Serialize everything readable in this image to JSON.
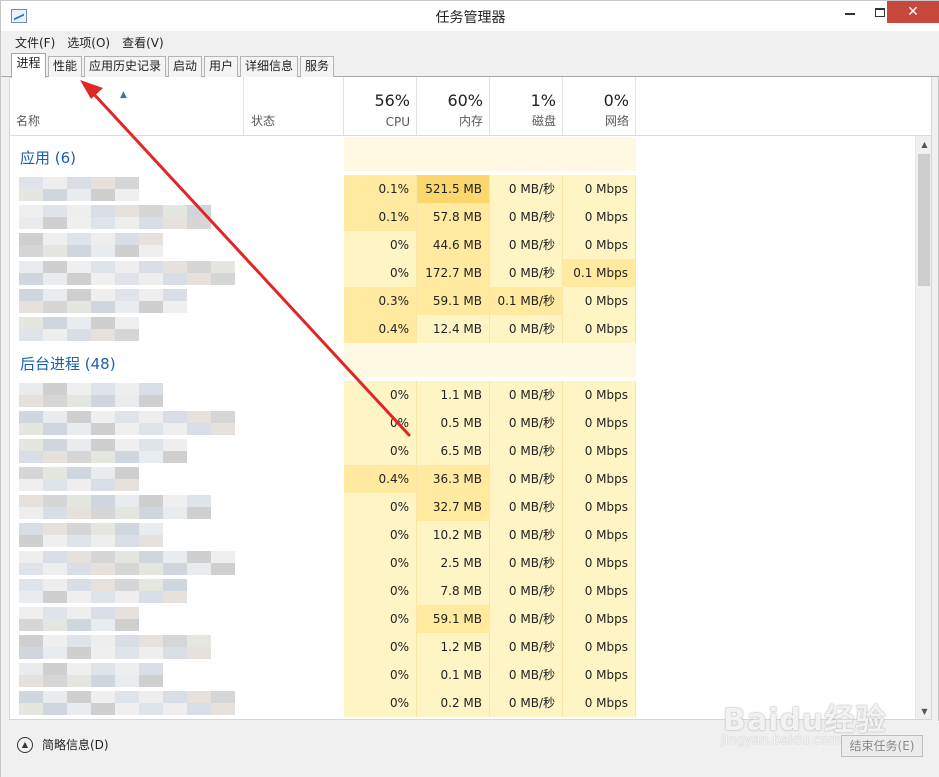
{
  "window": {
    "title": "任务管理器",
    "close_glyph": "✕"
  },
  "menu": [
    "文件(F)",
    "选项(O)",
    "查看(V)"
  ],
  "tabs": [
    "进程",
    "性能",
    "应用历史记录",
    "启动",
    "用户",
    "详细信息",
    "服务"
  ],
  "active_tab": "进程",
  "columns": {
    "name": "名称",
    "status": "状态",
    "metrics": [
      {
        "pct": "56%",
        "label": "CPU"
      },
      {
        "pct": "60%",
        "label": "内存"
      },
      {
        "pct": "1%",
        "label": "磁盘"
      },
      {
        "pct": "0%",
        "label": "网络"
      }
    ]
  },
  "groups": [
    {
      "title": "应用 (6)",
      "rows": [
        {
          "cpu": "0.1%",
          "mem": "521.5 MB",
          "disk": "0 MB/秒",
          "net": "0 Mbps"
        },
        {
          "cpu": "0.1%",
          "mem": "57.8 MB",
          "disk": "0 MB/秒",
          "net": "0 Mbps"
        },
        {
          "cpu": "0%",
          "mem": "44.6 MB",
          "disk": "0 MB/秒",
          "net": "0 Mbps"
        },
        {
          "cpu": "0%",
          "mem": "172.7 MB",
          "disk": "0 MB/秒",
          "net": "0.1 Mbps"
        },
        {
          "cpu": "0.3%",
          "mem": "59.1 MB",
          "disk": "0.1 MB/秒",
          "net": "0 Mbps"
        },
        {
          "cpu": "0.4%",
          "mem": "12.4 MB",
          "disk": "0 MB/秒",
          "net": "0 Mbps"
        }
      ]
    },
    {
      "title": "后台进程 (48)",
      "rows": [
        {
          "cpu": "0%",
          "mem": "1.1 MB",
          "disk": "0 MB/秒",
          "net": "0 Mbps"
        },
        {
          "cpu": "0%",
          "mem": "0.5 MB",
          "disk": "0 MB/秒",
          "net": "0 Mbps"
        },
        {
          "cpu": "0%",
          "mem": "6.5 MB",
          "disk": "0 MB/秒",
          "net": "0 Mbps"
        },
        {
          "cpu": "0.4%",
          "mem": "36.3 MB",
          "disk": "0 MB/秒",
          "net": "0 Mbps"
        },
        {
          "cpu": "0%",
          "mem": "32.7 MB",
          "disk": "0 MB/秒",
          "net": "0 Mbps"
        },
        {
          "cpu": "0%",
          "mem": "10.2 MB",
          "disk": "0 MB/秒",
          "net": "0 Mbps"
        },
        {
          "cpu": "0%",
          "mem": "2.5 MB",
          "disk": "0 MB/秒",
          "net": "0 Mbps"
        },
        {
          "cpu": "0%",
          "mem": "7.8 MB",
          "disk": "0 MB/秒",
          "net": "0 Mbps"
        },
        {
          "cpu": "0%",
          "mem": "59.1 MB",
          "disk": "0 MB/秒",
          "net": "0 Mbps"
        },
        {
          "cpu": "0%",
          "mem": "1.2 MB",
          "disk": "0 MB/秒",
          "net": "0 Mbps"
        },
        {
          "cpu": "0%",
          "mem": "0.1 MB",
          "disk": "0 MB/秒",
          "net": "0 Mbps"
        },
        {
          "cpu": "0%",
          "mem": "0.2 MB",
          "disk": "0 MB/秒",
          "net": "0 Mbps"
        }
      ]
    }
  ],
  "footer": {
    "fewer_details": "简略信息(D)",
    "end_task": "结束任务(E)"
  },
  "watermark": {
    "brand": "Baidu经验",
    "url": "jingyan.baidu.com"
  },
  "colors": {
    "heat_low": "#fff4c4",
    "heat_mid": "#ffeaa0",
    "heat_high": "#fcd76e",
    "group_band": "#fff9e3",
    "group_title": "#1b5fae",
    "arrow": "#e02626"
  }
}
